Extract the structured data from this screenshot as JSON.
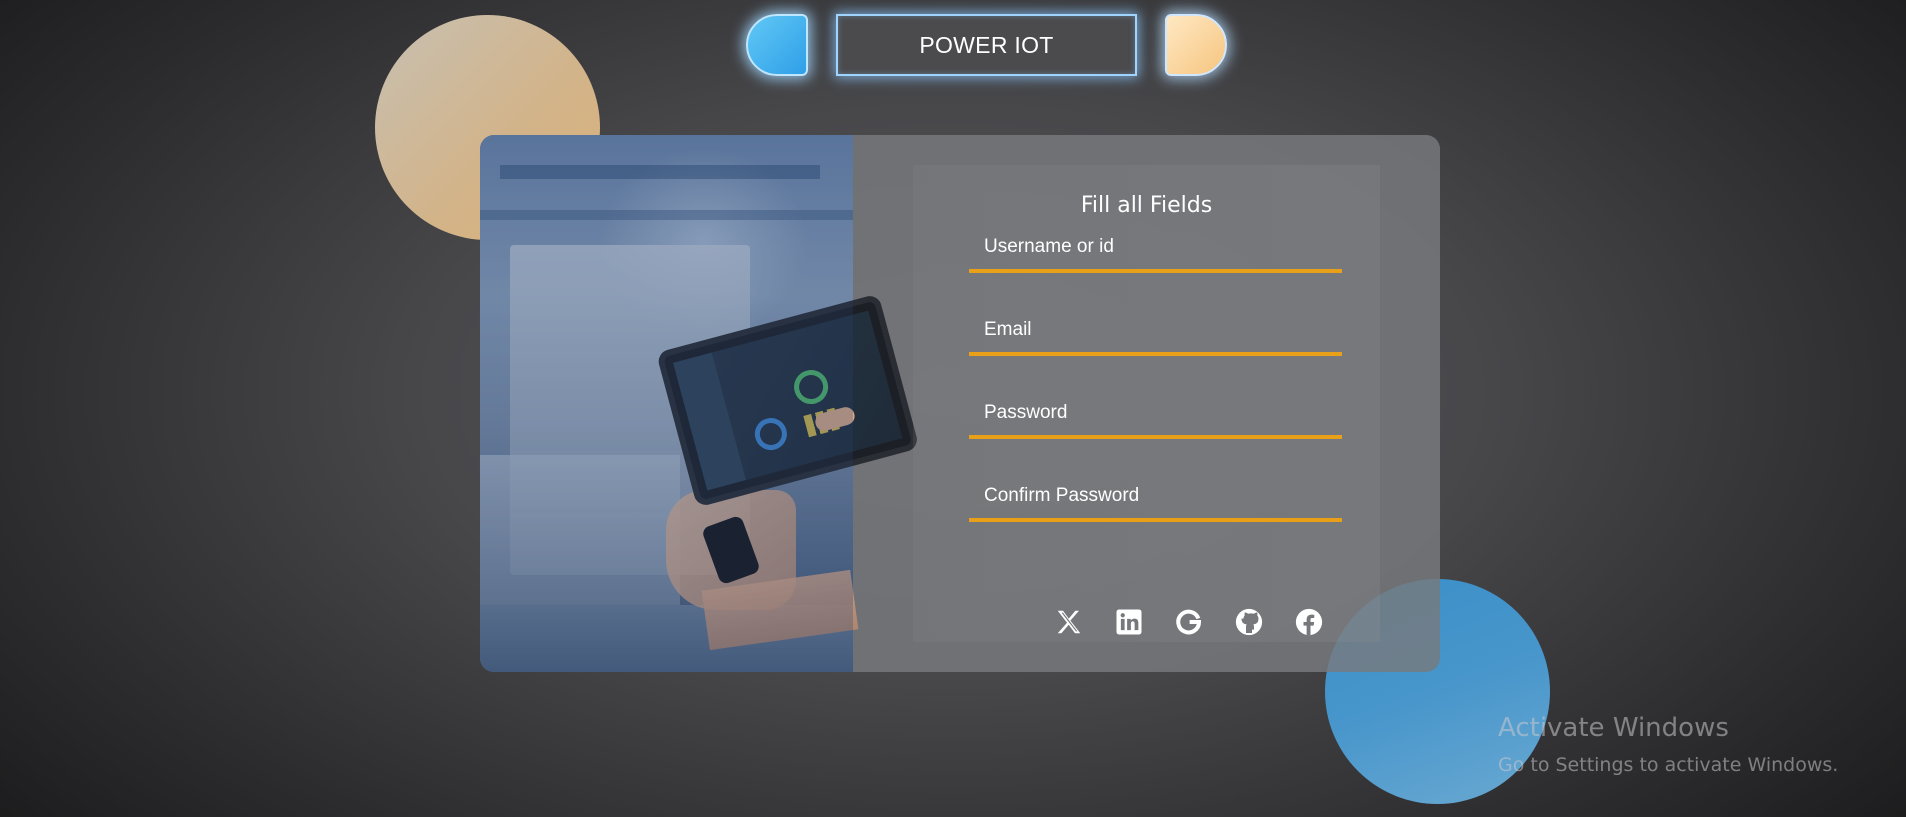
{
  "header": {
    "brand_title": "POWER IOT"
  },
  "form": {
    "title": "Fill all Fields",
    "fields": [
      {
        "placeholder": "Username or id",
        "value": ""
      },
      {
        "placeholder": "Email",
        "value": ""
      },
      {
        "placeholder": "Password",
        "value": ""
      },
      {
        "placeholder": "Confirm Password",
        "value": ""
      }
    ],
    "field_underline_color": "#e7a018"
  },
  "social": {
    "icons": [
      "x-icon",
      "linkedin-icon",
      "google-icon",
      "github-icon",
      "facebook-icon"
    ]
  },
  "watermark": {
    "title": "Activate Windows",
    "subtitle": "Go to Settings to activate Windows."
  },
  "colors": {
    "accent_blue": "#2f9fe8",
    "accent_peach": "#f6c57f",
    "glow": "#9ed4ff"
  }
}
